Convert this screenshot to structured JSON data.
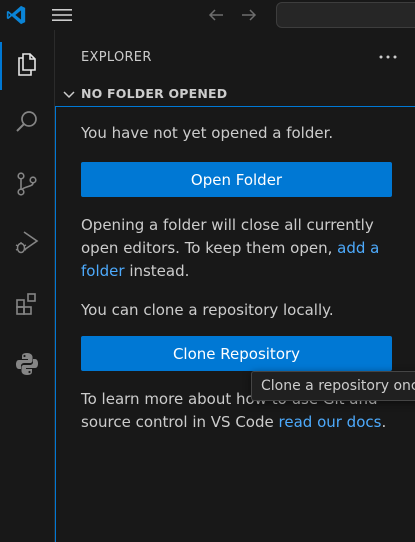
{
  "titlebar": {
    "icons": [
      "vscode-logo-icon",
      "hamburger-menu-icon",
      "back-arrow-icon",
      "forward-arrow-icon"
    ],
    "accent_color": "#0078d4"
  },
  "activitybar": {
    "items": [
      {
        "icon": "files-icon",
        "active": true
      },
      {
        "icon": "search-icon",
        "active": false
      },
      {
        "icon": "source-control-icon",
        "active": false
      },
      {
        "icon": "run-debug-icon",
        "active": false
      },
      {
        "icon": "extensions-icon",
        "active": false
      },
      {
        "icon": "python-icon",
        "active": false
      }
    ]
  },
  "sidebar": {
    "title": "EXPLORER",
    "more_icon": "ellipsis-icon",
    "section": {
      "title": "NO FOLDER OPENED",
      "chevron_icon": "chevron-down-icon"
    },
    "message_no_folder": "You have not yet opened a folder.",
    "open_folder_label": "Open Folder",
    "opening_text_before": "Opening a folder will close all currently open editors. To keep them open, ",
    "add_folder_link": "add a folder",
    "opening_text_after": " instead.",
    "clone_text": "You can clone a repository locally.",
    "clone_button_label": "Clone Repository",
    "learn_text_before": "To learn more about how to use Git and source control in VS Code ",
    "docs_link": "read our docs",
    "learn_text_after": ".",
    "button_color": "#0078d4",
    "link_color": "#4daafc"
  },
  "tooltip": {
    "text": "Clone a repository once"
  }
}
